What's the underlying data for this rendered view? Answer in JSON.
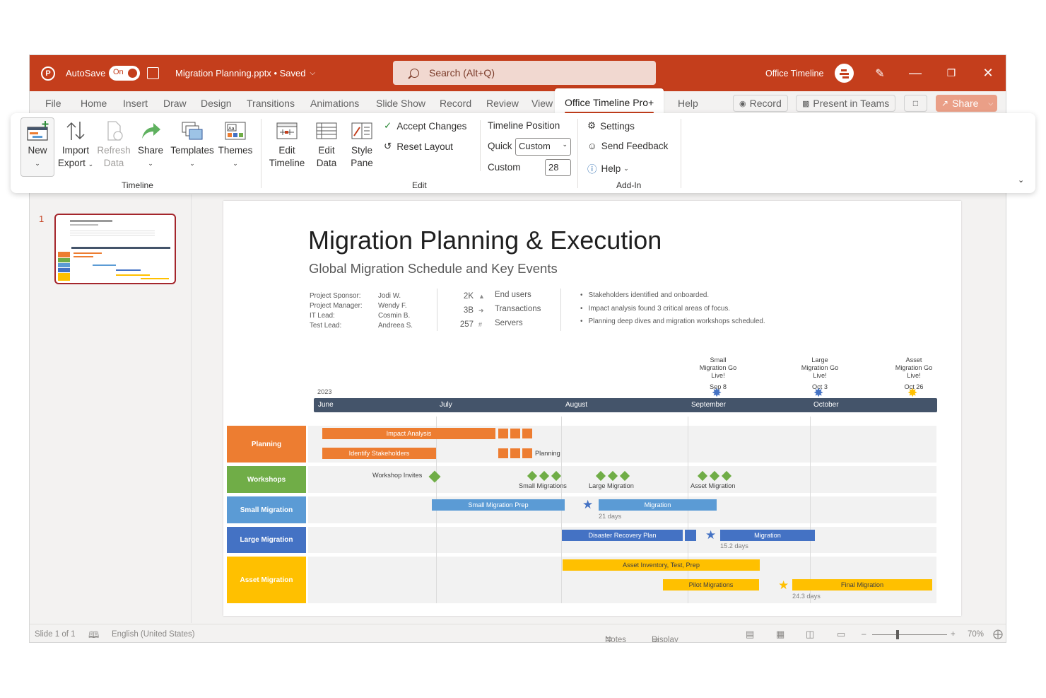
{
  "titlebar": {
    "autosave_label": "AutoSave",
    "autosave_state": "On",
    "file_name": "Migration Planning.pptx • Saved",
    "search_placeholder": "Search (Alt+Q)",
    "addin_name": "Office Timeline"
  },
  "menu": {
    "tabs": [
      "File",
      "Home",
      "Insert",
      "Draw",
      "Design",
      "Transitions",
      "Animations",
      "Slide Show",
      "Record",
      "Review",
      "View",
      "Office Timeline Pro+",
      "Help"
    ],
    "record_label": "Record",
    "present_label": "Present in Teams",
    "share_label": "Share"
  },
  "ribbon": {
    "new": "New",
    "import": "Import",
    "export": "Export",
    "refresh": "Refresh",
    "data": "Data",
    "share": "Share",
    "templates": "Templates",
    "themes": "Themes",
    "group_timeline": "Timeline",
    "edit": "Edit",
    "timeline": "Timeline",
    "style": "Style",
    "pane": "Pane",
    "accept_changes": "Accept Changes",
    "reset_layout": "Reset Layout",
    "timeline_position": "Timeline Position",
    "quick": "Quick",
    "quick_value": "Custom",
    "custom": "Custom",
    "custom_value": "28",
    "group_edit": "Edit",
    "settings": "Settings",
    "send_feedback": "Send Feedback",
    "help": "Help",
    "group_addin": "Add-In"
  },
  "slide_pane": {
    "slide_number": "1"
  },
  "slide": {
    "title": "Migration Planning & Execution",
    "subtitle": "Global Migration Schedule and Key Events",
    "roles": [
      "Project Sponsor:",
      "Project Manager:",
      "IT Lead:",
      "Test Lead:"
    ],
    "people": [
      "Jodi W.",
      "Wendy F.",
      "Cosmin B.",
      "Andreea S."
    ],
    "kpis": [
      {
        "value": "2K",
        "label": "End users"
      },
      {
        "value": "3B",
        "label": "Transactions"
      },
      {
        "value": "257",
        "label": "Servers"
      }
    ],
    "bullets": [
      "Stakeholders identified and onboarded.",
      "Impact analysis found 3 critical areas of focus.",
      "Planning deep dives and migration workshops scheduled."
    ],
    "year": "2023",
    "months": [
      "June",
      "July",
      "August",
      "September",
      "October"
    ],
    "milestones": [
      {
        "title": "Small Migration Go Live!",
        "date": "Sep 8",
        "color": "#4472c4"
      },
      {
        "title": "Large Migration Go Live!",
        "date": "Oct 3",
        "color": "#4472c4"
      },
      {
        "title": "Asset Migration Go Live!",
        "date": "Oct 26",
        "color": "#ffc000"
      }
    ],
    "rows": [
      {
        "name": "Planning",
        "color": "#ed7d31"
      },
      {
        "name": "Workshops",
        "color": "#70ad47"
      },
      {
        "name": "Small Migration",
        "color": "#5b9bd5"
      },
      {
        "name": "Large Migration",
        "color": "#4472c4"
      },
      {
        "name": "Asset Migration",
        "color": "#ffc000"
      }
    ],
    "tasks": {
      "impact_analysis": "Impact Analysis",
      "identify_stakeholders": "Identify Stakeholders",
      "planning": "Planning",
      "workshop_invites": "Workshop Invites",
      "small_migrations": "Small Migrations",
      "large_migration": "Large Migration",
      "asset_migration": "Asset Migration",
      "small_migration_prep": "Small Migration Prep",
      "migration": "Migration",
      "days_21": "21 days",
      "disaster_recovery": "Disaster Recovery Plan",
      "migration2": "Migration",
      "days_15": "15.2 days",
      "asset_inventory": "Asset Inventory, Test, Prep",
      "pilot_migrations": "Pilot Migrations",
      "final_migration": "Final Migration",
      "days_24": "24.3 days"
    }
  },
  "status": {
    "slide_of": "Slide 1 of 1",
    "language": "English (United States)",
    "notes": "Notes",
    "display_settings": "Display Settings",
    "zoom": "70%"
  }
}
